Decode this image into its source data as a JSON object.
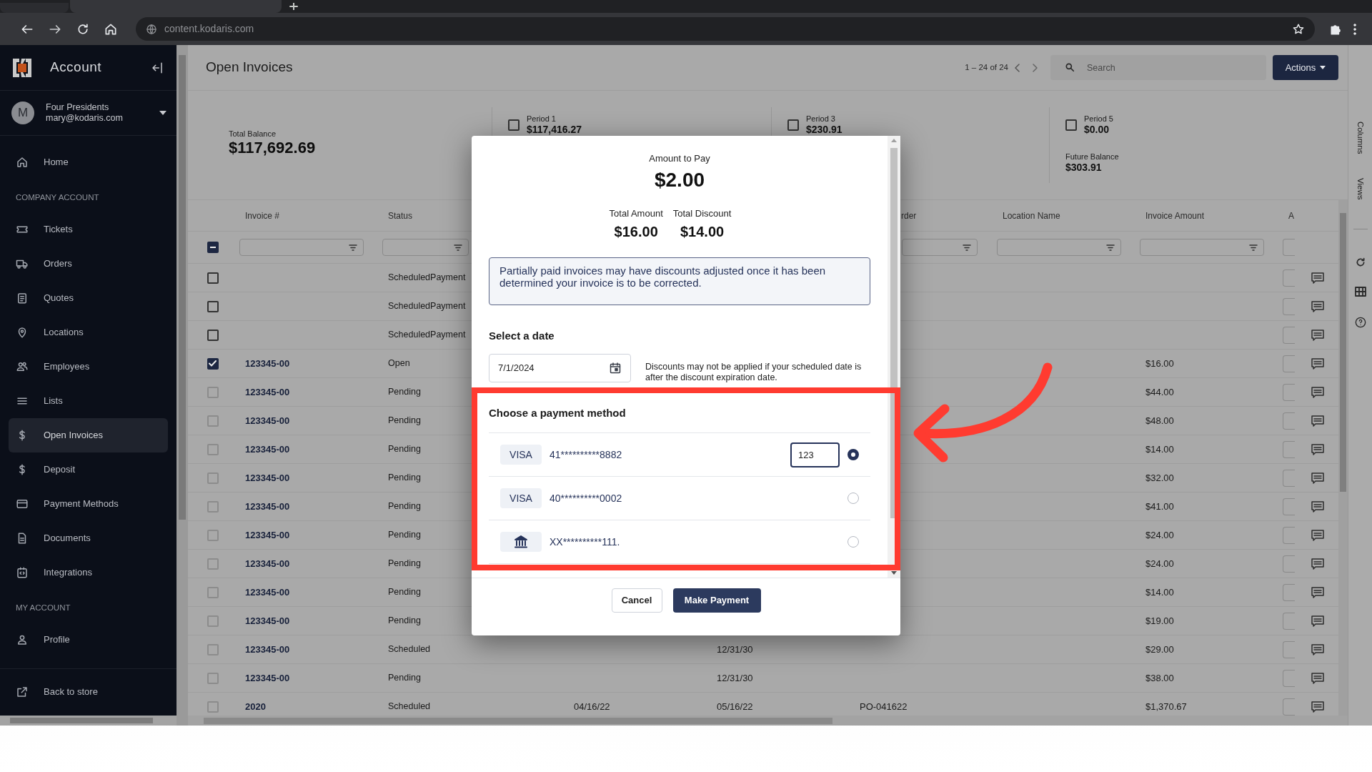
{
  "browser": {
    "url": "content.kodaris.com"
  },
  "sidebar": {
    "title": "Account",
    "user": {
      "initial": "M",
      "name": "Four Presidents",
      "email": "mary@kodaris.com"
    },
    "nav": [
      {
        "kind": "item",
        "label": "Home",
        "selected": false
      },
      {
        "kind": "heading",
        "label": "COMPANY ACCOUNT"
      },
      {
        "kind": "item",
        "label": "Tickets",
        "selected": false
      },
      {
        "kind": "item",
        "label": "Orders",
        "selected": false
      },
      {
        "kind": "item",
        "label": "Quotes",
        "selected": false
      },
      {
        "kind": "item",
        "label": "Locations",
        "selected": false
      },
      {
        "kind": "item",
        "label": "Employees",
        "selected": false
      },
      {
        "kind": "item",
        "label": "Lists",
        "selected": false
      },
      {
        "kind": "item",
        "label": "Open Invoices",
        "selected": true
      },
      {
        "kind": "item",
        "label": "Deposit",
        "selected": false
      },
      {
        "kind": "item",
        "label": "Payment Methods",
        "selected": false
      },
      {
        "kind": "item",
        "label": "Documents",
        "selected": false
      },
      {
        "kind": "item",
        "label": "Integrations",
        "selected": false
      },
      {
        "kind": "heading",
        "label": "MY ACCOUNT"
      },
      {
        "kind": "item",
        "label": "Profile",
        "selected": false
      }
    ],
    "footer_link": "Back to store"
  },
  "header": {
    "title": "Open Invoices",
    "pager": "1 – 24 of 24",
    "search": {
      "placeholder": "Search"
    },
    "actions": "Actions"
  },
  "summary": {
    "total": {
      "label": "Total Balance",
      "value": "$117,692.69"
    },
    "periods": [
      {
        "label": "Period 1",
        "value": "$117,416.27",
        "checked": false
      },
      {
        "label": "Period 3",
        "value": "$230.91",
        "checked": false
      },
      {
        "label": "Period 5",
        "value": "$0.00",
        "checked": false
      }
    ],
    "future": {
      "label": "Future Balance",
      "value": "$303.91"
    }
  },
  "side_panel": {
    "tabs": [
      "Columns",
      "Views"
    ]
  },
  "table": {
    "select_all": {
      "indeterminate": true
    },
    "columns": [
      {
        "label": "Invoice #"
      },
      {
        "label": "Status"
      },
      {
        "label": "rder"
      },
      {
        "label": "Location Name"
      },
      {
        "label": "Invoice Amount"
      },
      {
        "label": "A"
      }
    ],
    "rows": [
      {
        "checked": false,
        "disabled": false,
        "status": "ScheduledPayment"
      },
      {
        "checked": false,
        "disabled": false,
        "status": "ScheduledPayment"
      },
      {
        "checked": false,
        "disabled": false,
        "status": "ScheduledPayment"
      },
      {
        "checked": true,
        "disabled": false,
        "invoice": "123345-00",
        "status": "Open",
        "amount": "$16.00"
      },
      {
        "checked": false,
        "disabled": true,
        "invoice": "123345-00",
        "status": "Pending",
        "amount": "$44.00"
      },
      {
        "checked": false,
        "disabled": true,
        "invoice": "123345-00",
        "status": "Pending",
        "amount": "$48.00"
      },
      {
        "checked": false,
        "disabled": true,
        "invoice": "123345-00",
        "status": "Pending",
        "amount": "$14.00"
      },
      {
        "checked": false,
        "disabled": true,
        "invoice": "123345-00",
        "status": "Pending",
        "amount": "$32.00"
      },
      {
        "checked": false,
        "disabled": true,
        "invoice": "123345-00",
        "status": "Pending",
        "amount": "$41.00"
      },
      {
        "checked": false,
        "disabled": true,
        "invoice": "123345-00",
        "status": "Pending",
        "amount": "$24.00"
      },
      {
        "checked": false,
        "disabled": true,
        "invoice": "123345-00",
        "status": "Pending",
        "amount": "$24.00"
      },
      {
        "checked": false,
        "disabled": true,
        "invoice": "123345-00",
        "status": "Pending",
        "amount": "$14.00"
      },
      {
        "checked": false,
        "disabled": true,
        "invoice": "123345-00",
        "status": "Pending",
        "amount": "$19.00"
      },
      {
        "checked": false,
        "disabled": true,
        "invoice": "123345-00",
        "status": "Scheduled",
        "column_4": "12/31/30",
        "amount": "$29.00"
      },
      {
        "checked": false,
        "disabled": true,
        "invoice": "123345-00",
        "status": "Pending",
        "column_4": "12/31/30",
        "amount": "$38.00"
      },
      {
        "checked": false,
        "disabled": true,
        "invoice": "2020",
        "status": "Scheduled",
        "column_3": "04/16/22",
        "column_4": "05/16/22",
        "column_5": "PO-041622",
        "amount": "$1,370.67"
      }
    ]
  },
  "modal": {
    "amount_label": "Amount to Pay",
    "amount": "$2.00",
    "totals": [
      {
        "label": "Total Amount",
        "value": "$16.00"
      },
      {
        "label": "Total Discount",
        "value": "$14.00"
      }
    ],
    "notice": "Partially paid invoices may have discounts adjusted once it has been determined your invoice is to be corrected.",
    "date_label": "Select a date",
    "date": "7/1/2024",
    "date_hint": "Discounts may not be applied if your scheduled date is after the discount expiration date.",
    "methods_label": "Choose a payment method",
    "methods": [
      {
        "kind": "card",
        "brand": "VISA",
        "number": "41**********8882",
        "cvv": "123",
        "selected": true
      },
      {
        "kind": "card",
        "brand": "VISA",
        "number": "40**********0002",
        "selected": false
      },
      {
        "kind": "bank",
        "number": "XX**********111.",
        "selected": false
      }
    ],
    "buttons": {
      "cancel": "Cancel",
      "submit": "Make Payment"
    }
  }
}
